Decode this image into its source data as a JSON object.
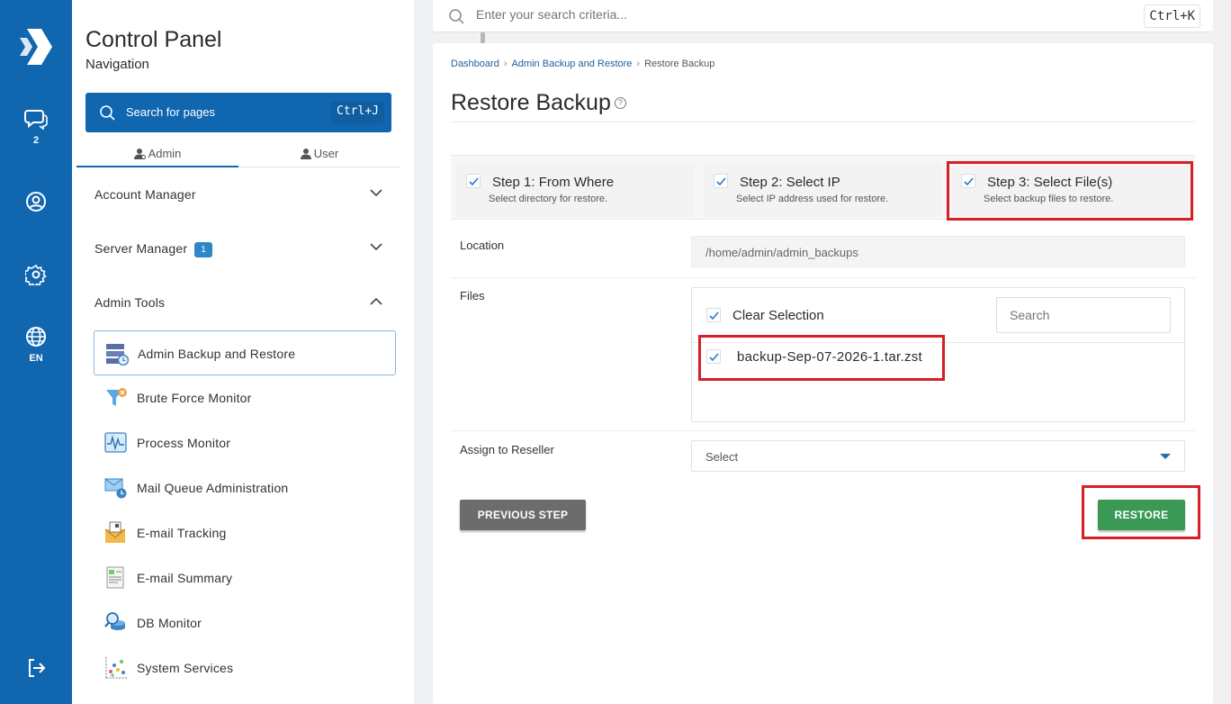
{
  "app": {
    "title": "Control Panel",
    "subtitle": "Navigation"
  },
  "rail": {
    "items": [
      {
        "name": "chat-icon",
        "badge": "2"
      },
      {
        "name": "user-circle-icon",
        "badge": ""
      },
      {
        "name": "gear-icon",
        "badge": ""
      },
      {
        "name": "globe-icon",
        "badge": "EN"
      },
      {
        "name": "logout-icon",
        "badge": ""
      }
    ]
  },
  "nav": {
    "search_placeholder": "Search for pages",
    "search_shortcut": "Ctrl+J",
    "tabs": [
      {
        "label": "Admin"
      },
      {
        "label": "User"
      }
    ],
    "sections": [
      {
        "label": "Account Manager",
        "expanded": false
      },
      {
        "label": "Server Manager",
        "badge": "1",
        "expanded": false
      },
      {
        "label": "Admin Tools",
        "expanded": true
      }
    ],
    "items": [
      {
        "label": "Admin Backup and Restore",
        "icon": "backup-icon",
        "active": true
      },
      {
        "label": "Brute Force Monitor",
        "icon": "funnel-icon"
      },
      {
        "label": "Process Monitor",
        "icon": "pulse-monitor-icon"
      },
      {
        "label": "Mail Queue Administration",
        "icon": "mail-clock-icon"
      },
      {
        "label": "E-mail Tracking",
        "icon": "mail-tracking-icon"
      },
      {
        "label": "E-mail Summary",
        "icon": "document-summary-icon"
      },
      {
        "label": "DB Monitor",
        "icon": "db-magnifier-icon"
      },
      {
        "label": "System Services",
        "icon": "scatter-services-icon"
      }
    ]
  },
  "topbar": {
    "search_placeholder": "Enter your search criteria...",
    "shortcut": "Ctrl+K"
  },
  "breadcrumb": [
    "Dashboard",
    "Admin Backup and Restore",
    "Restore Backup"
  ],
  "page": {
    "title": "Restore Backup"
  },
  "steps": [
    {
      "title": "Step 1: From Where",
      "desc": "Select directory for restore."
    },
    {
      "title": "Step 2: Select IP",
      "desc": "Select IP address used for restore."
    },
    {
      "title": "Step 3: Select File(s)",
      "desc": "Select backup files to restore."
    }
  ],
  "form": {
    "location_label": "Location",
    "location_value": "/home/admin/admin_backups",
    "files_label": "Files",
    "clear_selection": "Clear Selection",
    "files_search_placeholder": "Search",
    "files": [
      {
        "name": "backup-Sep-07-2026-1.tar.zst",
        "checked": true
      }
    ],
    "reseller_label": "Assign to Reseller",
    "reseller_value": "Select"
  },
  "buttons": {
    "previous": "PREVIOUS STEP",
    "restore": "RESTORE"
  },
  "colors": {
    "brand": "#1166b0",
    "success": "#3a9a55",
    "highlight": "#d61f26"
  }
}
